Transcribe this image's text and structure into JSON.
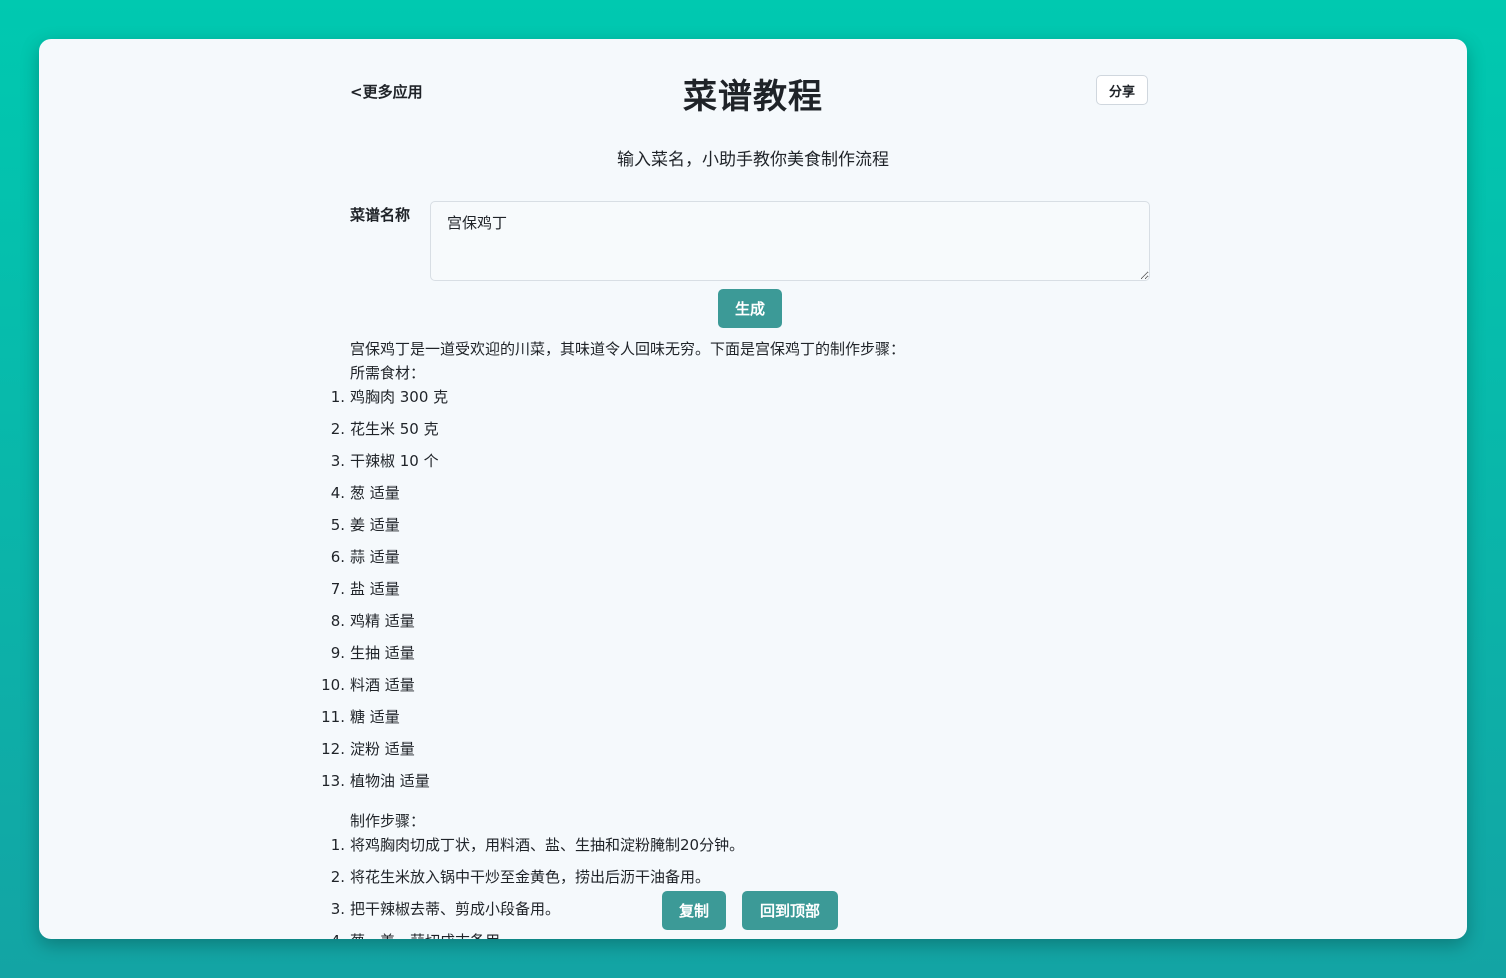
{
  "header": {
    "more_apps": "<更多应用",
    "title": "菜谱教程",
    "share": "分享"
  },
  "subtitle": "输入菜名，小助手教你美食制作流程",
  "form": {
    "label": "菜谱名称",
    "input_value": "宫保鸡丁",
    "generate": "生成"
  },
  "result": {
    "intro": "宫保鸡丁是一道受欢迎的川菜，其味道令人回味无穷。下面是宫保鸡丁的制作步骤：",
    "ingredients_heading": "所需食材：",
    "ingredients": [
      "鸡胸肉 300 克",
      "花生米 50 克",
      "干辣椒 10 个",
      "葱 适量",
      "姜 适量",
      "蒜 适量",
      "盐 适量",
      "鸡精 适量",
      "生抽 适量",
      "料酒 适量",
      "糖 适量",
      "淀粉 适量",
      "植物油 适量"
    ],
    "steps_heading": "制作步骤：",
    "steps": [
      "将鸡胸肉切成丁状，用料酒、盐、生抽和淀粉腌制20分钟。",
      "将花生米放入锅中干炒至金黄色，捞出后沥干油备用。",
      "把干辣椒去蒂、剪成小段备用。",
      "葱、姜、蒜切成末备用。"
    ]
  },
  "actions": {
    "copy": "复制",
    "back_to_top": "回到顶部"
  }
}
